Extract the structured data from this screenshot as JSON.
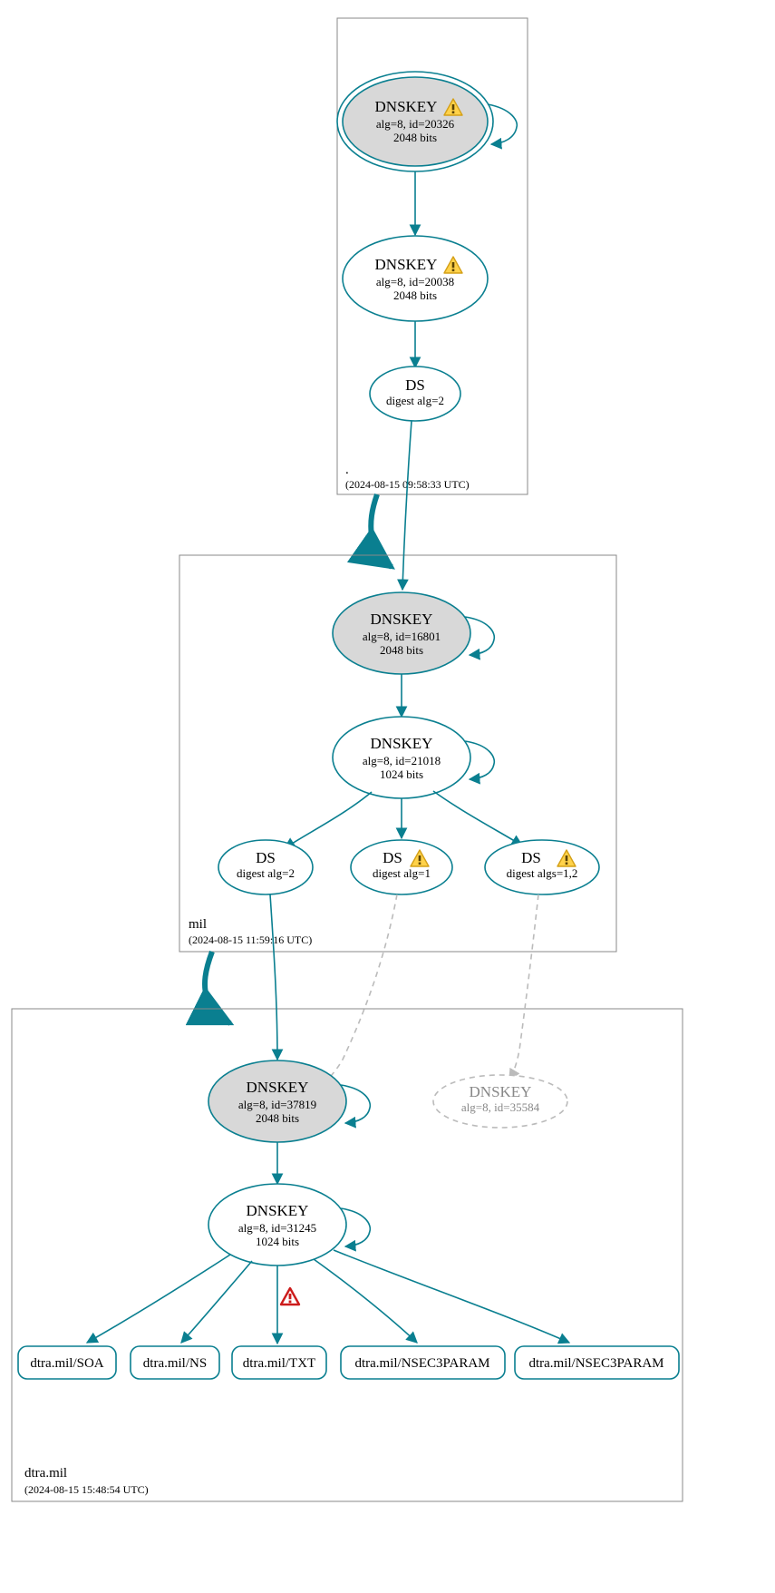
{
  "colors": {
    "stroke": "#0a7f90",
    "fill_grey": "#d8d8d8",
    "ghost": "#bbbbbb"
  },
  "icons": {
    "warn_yellow": "warning-icon",
    "warn_red": "error-icon"
  },
  "zones": {
    "root": {
      "label": ".",
      "timestamp": "(2024-08-15 09:58:33 UTC)"
    },
    "mil": {
      "label": "mil",
      "timestamp": "(2024-08-15 11:59:16 UTC)"
    },
    "dtra": {
      "label": "dtra.mil",
      "timestamp": "(2024-08-15 15:48:54 UTC)"
    }
  },
  "nodes": {
    "root_ksk": {
      "title": "DNSKEY",
      "line2": "alg=8, id=20326",
      "line3": "2048 bits",
      "warn": true
    },
    "root_zsk": {
      "title": "DNSKEY",
      "line2": "alg=8, id=20038",
      "line3": "2048 bits",
      "warn": true
    },
    "root_ds": {
      "title": "DS",
      "line2": "digest alg=2"
    },
    "mil_ksk": {
      "title": "DNSKEY",
      "line2": "alg=8, id=16801",
      "line3": "2048 bits"
    },
    "mil_zsk": {
      "title": "DNSKEY",
      "line2": "alg=8, id=21018",
      "line3": "1024 bits"
    },
    "mil_ds1": {
      "title": "DS",
      "line2": "digest alg=2"
    },
    "mil_ds2": {
      "title": "DS",
      "line2": "digest alg=1",
      "warn": true
    },
    "mil_ds3": {
      "title": "DS",
      "line2": "digest algs=1,2",
      "warn": true
    },
    "dtra_ksk": {
      "title": "DNSKEY",
      "line2": "alg=8, id=37819",
      "line3": "2048 bits"
    },
    "dtra_ghost": {
      "title": "DNSKEY",
      "line2": "alg=8, id=35584"
    },
    "dtra_zsk": {
      "title": "DNSKEY",
      "line2": "alg=8, id=31245",
      "line3": "1024 bits"
    }
  },
  "leaves": {
    "soa": "dtra.mil/SOA",
    "ns": "dtra.mil/NS",
    "txt": "dtra.mil/TXT",
    "n3p1": "dtra.mil/NSEC3PARAM",
    "n3p2": "dtra.mil/NSEC3PARAM"
  }
}
